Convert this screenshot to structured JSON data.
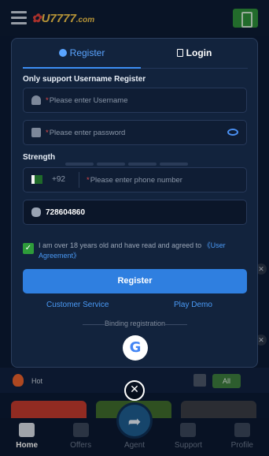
{
  "header": {
    "logo_text": "U7777",
    "logo_suffix": ".com"
  },
  "modal": {
    "tabs": [
      {
        "label": "Register",
        "active": true
      },
      {
        "label": "Login",
        "active": false
      }
    ],
    "note": "Only support Username Register",
    "username": {
      "placeholder": "Please enter Username"
    },
    "password": {
      "placeholder": "Please enter password"
    },
    "strength": {
      "label": "Strength"
    },
    "phone": {
      "country_code": "+92",
      "placeholder": "Please enter phone number"
    },
    "code": {
      "value": "728604860"
    },
    "agreement": {
      "text": "I am over 18 years old and have read and agreed to ",
      "link": "《User Agreement》",
      "checked": true
    },
    "register_button": "Register",
    "customer_service": "Customer Service",
    "play_demo": "Play Demo",
    "binding_label": "Binding registration",
    "google_letter": "G"
  },
  "background": {
    "hot_label": "Hot",
    "all_label": "All"
  },
  "bottom_nav": [
    {
      "label": "Home",
      "active": true
    },
    {
      "label": "Offers",
      "active": false
    },
    {
      "label": "Agent",
      "active": false
    },
    {
      "label": "Support",
      "active": false
    },
    {
      "label": "Profile",
      "active": false
    }
  ],
  "close_symbol": "✕",
  "colors": {
    "accent": "#2f7fe0",
    "check": "#2e9c3a",
    "required": "#e24b4b"
  }
}
